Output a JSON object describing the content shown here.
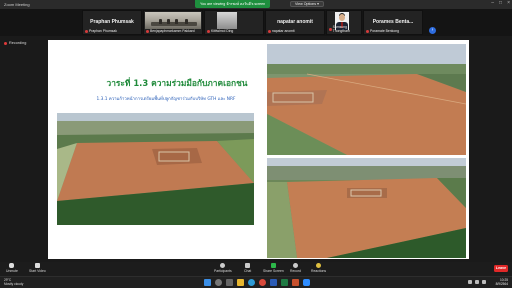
{
  "window": {
    "title": "Zoom Meeting",
    "share_banner": "You are viewing จักรพงษ์ คงวันดี's screen",
    "view_options": "View Options ▾"
  },
  "participants": [
    {
      "big_name": "Praphan Phumsak",
      "small_name": "Praphan Phumsak",
      "video": "none"
    },
    {
      "big_name": "",
      "small_name": "Benjapaphmarkamm Pakkard",
      "video": "office"
    },
    {
      "big_name": "",
      "small_name": "Kittiwimol Ding",
      "video": "small"
    },
    {
      "big_name": "napatar anomit",
      "small_name": "napatar anomit",
      "video": "none"
    },
    {
      "big_name": "",
      "small_name": "Samsung Thongtham",
      "video": "portrait"
    },
    {
      "big_name": "Porames Benta...",
      "small_name": "Poramate Benkong",
      "video": "none"
    }
  ],
  "recording_label": "Recording",
  "slide": {
    "title": "วาระที่ 1.3 ความร่วมมือกับภาคเอกชน",
    "subtitle": "1.3.1 ความก้าวหน้าการเตรียมพื้นที่ปลูกกัญชาร่วมกับบริษัท GTH และ NRF"
  },
  "toolbar": {
    "buttons": [
      {
        "label": "Unmute",
        "icon": "mic-off-icon"
      },
      {
        "label": "Start Video",
        "icon": "video-off-icon"
      },
      {
        "label": "Participants",
        "icon": "participants-icon"
      },
      {
        "label": "Chat",
        "icon": "chat-icon"
      },
      {
        "label": "Share Screen",
        "icon": "share-screen-icon"
      },
      {
        "label": "Record",
        "icon": "record-icon"
      },
      {
        "label": "Reactions",
        "icon": "reactions-icon"
      }
    ],
    "leave_label": "Leave"
  },
  "taskbar": {
    "weather_temp": "29°C",
    "weather_desc": "Mostly cloudy",
    "time": "10:25",
    "date": "8/9/2564"
  }
}
